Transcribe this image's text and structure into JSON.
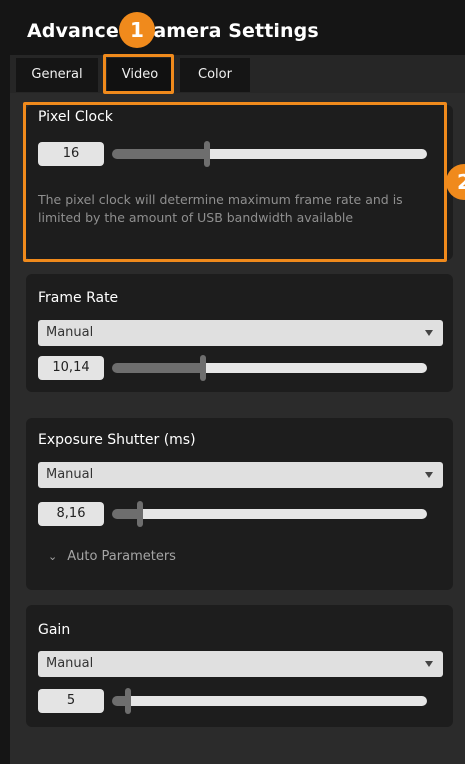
{
  "window": {
    "title": "Advanced Camera Settings"
  },
  "tabs": [
    {
      "label": "General"
    },
    {
      "label": "Video"
    },
    {
      "label": "Color"
    }
  ],
  "pixel_clock": {
    "title": "Pixel Clock",
    "value": "16",
    "slider_fraction": 0.3,
    "description": "The pixel clock will determine maximum frame rate and is limited by the amount of USB bandwidth available"
  },
  "frame_rate": {
    "title": "Frame Rate",
    "mode": "Manual",
    "value": "10,14",
    "slider_fraction": 0.29
  },
  "exposure": {
    "title": "Exposure Shutter (ms)",
    "mode": "Manual",
    "value": "8,16",
    "slider_fraction": 0.09,
    "auto_parameters_label": "Auto Parameters"
  },
  "gain": {
    "title": "Gain",
    "mode": "Manual",
    "value": "5",
    "slider_fraction": 0.05
  },
  "callouts": [
    {
      "number": "1"
    },
    {
      "number": "2"
    }
  ],
  "colors": {
    "accent": "#f08a1c",
    "panel": "#1d1d1d",
    "background": "#2b2b2b"
  }
}
